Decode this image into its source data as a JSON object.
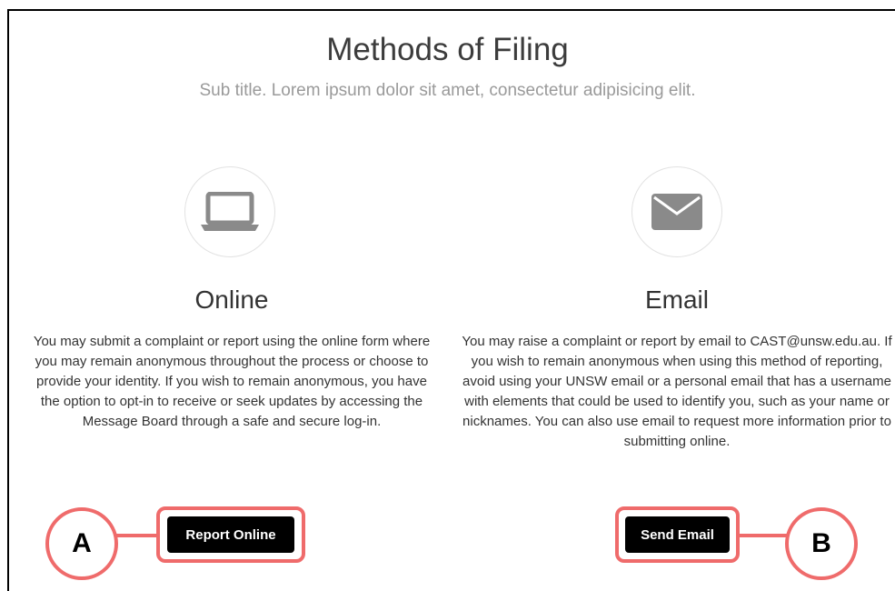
{
  "header": {
    "title": "Methods of Filing",
    "subtitle": "Sub title. Lorem ipsum dolor sit amet, consectetur adipisicing elit."
  },
  "online": {
    "icon": "laptop-icon",
    "title": "Online",
    "description": "You may submit a complaint or report using the online form where you may remain anonymous throughout the process or choose to provide your identity. If you wish to remain anonymous, you have the option to opt-in to receive or seek updates by accessing the Message Board through a safe and secure log-in.",
    "button_label": "Report Online"
  },
  "email": {
    "icon": "envelope-icon",
    "title": "Email",
    "description": "You may raise a complaint or report by email to CAST@unsw.edu.au. If you wish to remain anonymous when using this method of reporting, avoid using your UNSW email or a personal email that has a username with elements that could be used to identify you, such as your name or nicknames. You can also use email to request more information prior to submitting online.",
    "button_label": "Send Email"
  },
  "annotations": {
    "marker_a": "A",
    "marker_b": "B",
    "accent_color": "#ef6b6b"
  }
}
